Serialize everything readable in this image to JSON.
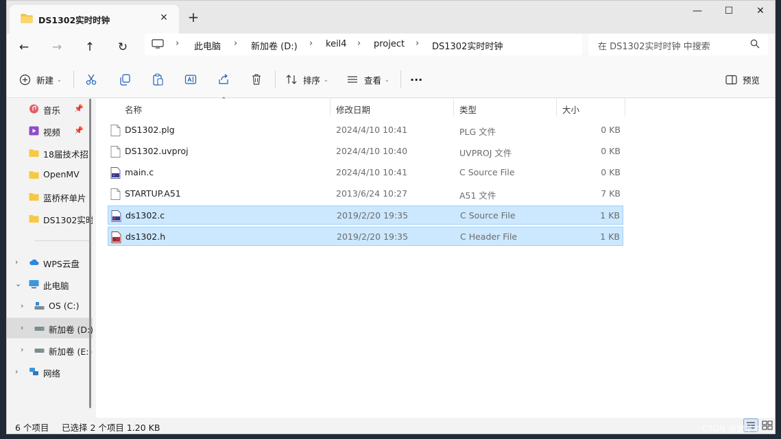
{
  "window": {
    "tab_title": "DS1302实时时钟",
    "close_tab": "✕",
    "new_tab": "+",
    "minimize": "—",
    "maximize": "☐",
    "close": "✕"
  },
  "breadcrumb": [
    "此电脑",
    "新加卷 (D:)",
    "keil4",
    "project",
    "DS1302实时时钟"
  ],
  "search": {
    "placeholder": "在 DS1302实时时钟 中搜索"
  },
  "toolbar": {
    "new_label": "新建",
    "sort_label": "排序",
    "view_label": "查看",
    "more": "···",
    "preview_label": "预览"
  },
  "navpane": {
    "quick_access": [
      {
        "label": "音乐",
        "icon": "music-icon",
        "pinned": true
      },
      {
        "label": "视频",
        "icon": "video-icon",
        "pinned": true
      },
      {
        "label": "18届技术招",
        "icon": "folder-icon"
      },
      {
        "label": "OpenMV",
        "icon": "folder-icon"
      },
      {
        "label": "蓝桥杯单片",
        "icon": "folder-icon"
      },
      {
        "label": "DS1302实时",
        "icon": "folder-icon"
      }
    ],
    "tree": [
      {
        "label": "WPS云盘",
        "icon": "cloud-icon",
        "expand": "›"
      },
      {
        "label": "此电脑",
        "icon": "pc-icon",
        "expand": "⌄"
      },
      {
        "label": "OS (C:)",
        "icon": "drive-icon",
        "expand": "›"
      },
      {
        "label": "新加卷 (D:)",
        "icon": "drive-icon",
        "expand": "›",
        "selected": true
      },
      {
        "label": "新加卷 (E:)",
        "icon": "drive-icon",
        "expand": "›"
      },
      {
        "label": "网络",
        "icon": "network-icon",
        "expand": "›"
      }
    ]
  },
  "columns": {
    "name": "名称",
    "date": "修改日期",
    "type": "类型",
    "size": "大小"
  },
  "files": [
    {
      "name": "DS1302.plg",
      "date": "2024/4/10 10:41",
      "type": "PLG 文件",
      "size": "0 KB",
      "icon": "generic-file-icon",
      "selected": false
    },
    {
      "name": "DS1302.uvproj",
      "date": "2024/4/10 10:40",
      "type": "UVPROJ 文件",
      "size": "0 KB",
      "icon": "generic-file-icon",
      "selected": false
    },
    {
      "name": "main.c",
      "date": "2024/4/10 10:41",
      "type": "C Source File",
      "size": "0 KB",
      "icon": "c-source-icon",
      "selected": false
    },
    {
      "name": "STARTUP.A51",
      "date": "2013/6/24 10:27",
      "type": "A51 文件",
      "size": "7 KB",
      "icon": "generic-file-icon",
      "selected": false
    },
    {
      "name": "ds1302.c",
      "date": "2019/2/20 19:35",
      "type": "C Source File",
      "size": "1 KB",
      "icon": "c-source-icon",
      "selected": true
    },
    {
      "name": "ds1302.h",
      "date": "2019/2/20 19:35",
      "type": "C Header File",
      "size": "1 KB",
      "icon": "c-header-icon",
      "selected": true
    }
  ],
  "status": {
    "count": "6 个项目",
    "selection": "已选择 2 个项目  1.20 KB"
  },
  "watermark": "CSDN @懒羊羊",
  "colors": {
    "selection_bg": "#cce8ff",
    "selection_border": "#99d1ff",
    "folder_yellow": "#f7c843",
    "accent_blue": "#0f6cbd"
  }
}
